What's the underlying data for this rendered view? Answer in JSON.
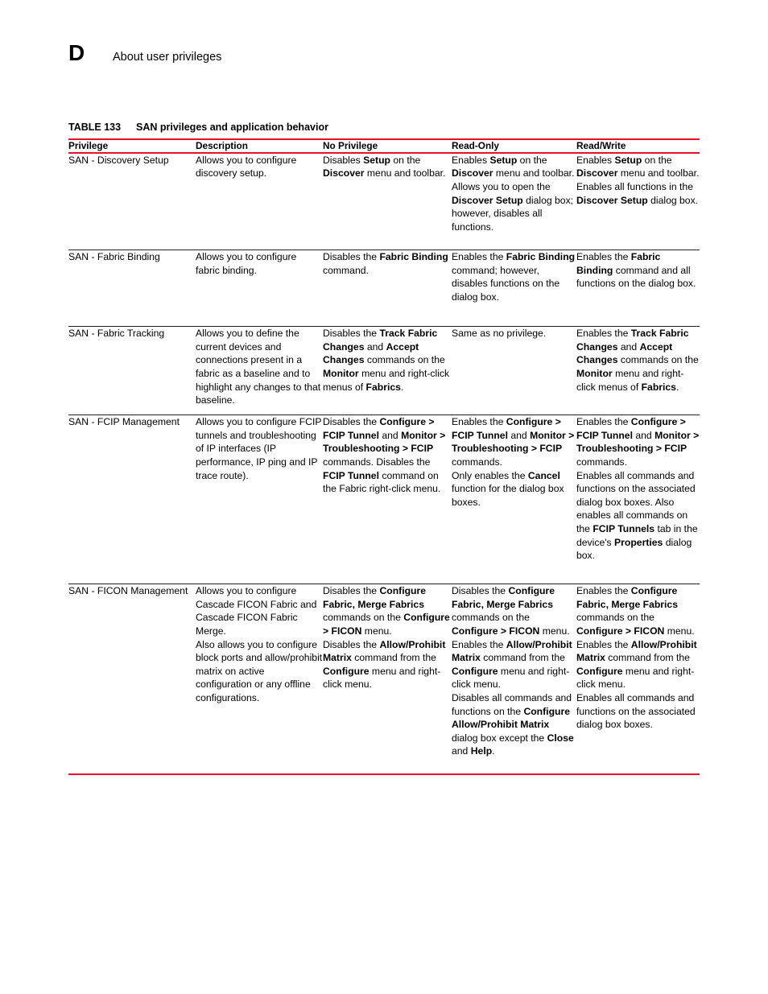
{
  "header": {
    "appendix_letter": "D",
    "title": "About user privileges"
  },
  "caption": {
    "label": "TABLE 133",
    "text": "SAN privileges and application behavior"
  },
  "colors": {
    "rule_red": "#E8112D",
    "rule_black": "#231f20",
    "text": "#000000"
  },
  "table": {
    "columns": [
      "Privilege",
      "Description",
      "No Privilege",
      "Read-Only",
      "Read/Write"
    ],
    "rows": [
      {
        "privilege": "SAN - Discovery Setup",
        "description": "Allows you to configure discovery setup.",
        "no_privilege": "Disables <b>Setup</b> on the <b>Discover</b> menu and toolbar.",
        "read_only": "Enables <b>Setup</b> on the <b>Discover</b> menu and toolbar.<br>Allows you to open the <b>Discover Setup</b> dialog box; however, disables all functions.",
        "read_write": "Enables <b>Setup</b> on the <b>Discover</b> menu and toolbar.<br>Enables all functions in the <b>Discover Setup</b> dialog box."
      },
      {
        "privilege": "SAN - Fabric Binding",
        "description": "Allows you to configure fabric binding.",
        "no_privilege": "Disables the <b>Fabric Binding</b> command.",
        "read_only": "Enables the <b>Fabric Binding</b> command; however, disables functions on the dialog box.",
        "read_write": "Enables the <b>Fabric Binding</b> command and all functions on the dialog box."
      },
      {
        "privilege": "SAN - Fabric Tracking",
        "description": "Allows you to define the current devices and connections present in a fabric as a baseline and to highlight any changes to that baseline.",
        "no_privilege": "Disables the <b>Track Fabric Changes</b> and <b>Accept Changes</b> commands on the <b>Monitor</b> menu and right-click menus of <b>Fabrics</b>.",
        "read_only": "Same as no privilege.",
        "read_write": "Enables the <b>Track Fabric Changes</b> and <b>Accept Changes</b> commands on the <b>Monitor</b> menu and right-click menus of <b>Fabrics</b>."
      },
      {
        "privilege": "SAN - FCIP Management",
        "description": "Allows you to configure FCIP tunnels and troubleshooting of IP interfaces (IP performance, IP ping and IP trace route).",
        "no_privilege": "Disables the <b>Configure &gt; FCIP Tunnel</b> and <b>Monitor &gt; Troubleshooting &gt; FCIP</b> commands. Disables the <b>FCIP Tunnel</b> command on the Fabric right-click menu.",
        "read_only": "Enables the <b>Configure &gt; FCIP Tunnel</b> and <b>Monitor &gt; Troubleshooting &gt; FCIP</b> commands.<br>Only enables the <b>Cancel</b> function for the dialog box boxes.",
        "read_write": "Enables the <b>Configure &gt; FCIP Tunnel</b> and <b>Monitor &gt; Troubleshooting &gt; FCIP</b> commands.<br>Enables all commands and functions on the associated dialog box boxes. Also enables all commands on the <b>FCIP Tunnels</b> tab in the device's <b>Properties</b> dialog box."
      },
      {
        "privilege": "SAN - FICON Management",
        "description": "Allows you to configure Cascade FICON Fabric and Cascade FICON Fabric Merge.<br>Also allows you to configure block ports and allow/prohibit matrix on active configuration or any offline configurations.",
        "no_privilege": "Disables the <b>Configure Fabric, Merge Fabrics</b> commands on the <b>Configure &gt; FICON</b> menu.<br>Disables the <b>Allow/Prohibit Matrix</b> command from the <b>Configure</b> menu and right-click menu.",
        "read_only": "Disables the <b>Configure Fabric, Merge Fabrics</b> commands on the <b>Configure &gt; FICON</b> menu.<br>Enables the <b>Allow/Prohibit Matrix</b> command from the <b>Configure</b> menu and right-click menu.<br>Disables all commands and functions on the <b>Configure Allow/Prohibit Matrix</b> dialog box except the <b>Close</b> and <b>Help</b>.",
        "read_write": "Enables the <b>Configure Fabric, Merge Fabrics</b> commands on the <b>Configure &gt; FICON</b> menu.<br>Enables the <b>Allow/Prohibit Matrix</b> command from the <b>Configure</b> menu and right-click menu.<br>Enables all commands and functions on the associated dialog box boxes."
      }
    ]
  }
}
